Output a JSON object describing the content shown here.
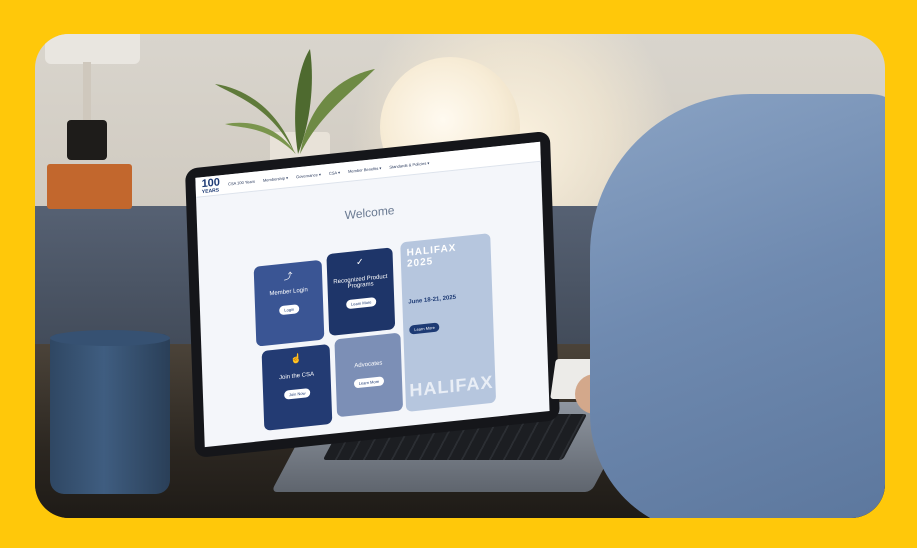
{
  "scene": {
    "description_hidden": "",
    "frame_color": "#ffc80a"
  },
  "laptop_screen": {
    "logo_text": "100",
    "logo_sub": "YEARS",
    "nav_items": [
      "CSA 100 Years",
      "Membership ▾",
      "Governance ▾",
      "CSA ▾",
      "Member Benefits ▾",
      "Standards & Policies ▾"
    ],
    "welcome_heading": "Welcome",
    "cards": [
      {
        "icon": "⤴",
        "title": "Member Login",
        "button": "Login"
      },
      {
        "icon": "✓",
        "title": "Recognized Product Programs",
        "button": "Learn More"
      },
      {
        "icon": "☝",
        "title": "Join the CSA",
        "button": "Join Now"
      },
      {
        "icon": "",
        "title": "Advocates",
        "button": "Learn More"
      }
    ],
    "promo": {
      "heading": "HALIFAX 2025",
      "date": "June 18-21, 2025",
      "button": "Learn More",
      "big_text": "HALIFAX"
    }
  }
}
